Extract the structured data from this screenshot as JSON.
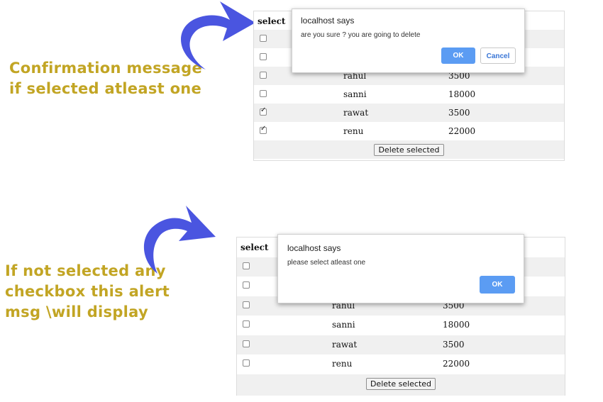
{
  "annotations": {
    "top": "Confirmation message\nif selected atleast one",
    "bottom": "If not selected any\ncheckbox this alert\nmsg \\will display",
    "arrow_icon": "curved-arrow-icon",
    "text_color": "#c2a524",
    "arrow_color": "#4a55e0"
  },
  "table": {
    "header_label": "select",
    "rows_top": [
      {
        "name": "",
        "amount": "",
        "checked": false
      },
      {
        "name": "",
        "amount": "",
        "checked": false
      },
      {
        "name": "rahul",
        "amount": "3500",
        "checked": false
      },
      {
        "name": "sanni",
        "amount": "18000",
        "checked": false
      },
      {
        "name": "rawat",
        "amount": "3500",
        "checked": true
      },
      {
        "name": "renu",
        "amount": "22000",
        "checked": true
      }
    ],
    "rows_bottom": [
      {
        "name": "",
        "amount": "",
        "checked": false
      },
      {
        "name": "",
        "amount": "",
        "checked": false
      },
      {
        "name": "rahul",
        "amount": "3500",
        "checked": false
      },
      {
        "name": "sanni",
        "amount": "18000",
        "checked": false
      },
      {
        "name": "rawat",
        "amount": "3500",
        "checked": false
      },
      {
        "name": "renu",
        "amount": "22000",
        "checked": false
      }
    ],
    "delete_label": "Delete selected"
  },
  "dialog_confirm": {
    "title": "localhost says",
    "message": "are you sure ? you are going to delete",
    "ok_label": "OK",
    "cancel_label": "Cancel"
  },
  "dialog_alert": {
    "title": "localhost says",
    "message": "please select atleast one",
    "ok_label": "OK"
  }
}
